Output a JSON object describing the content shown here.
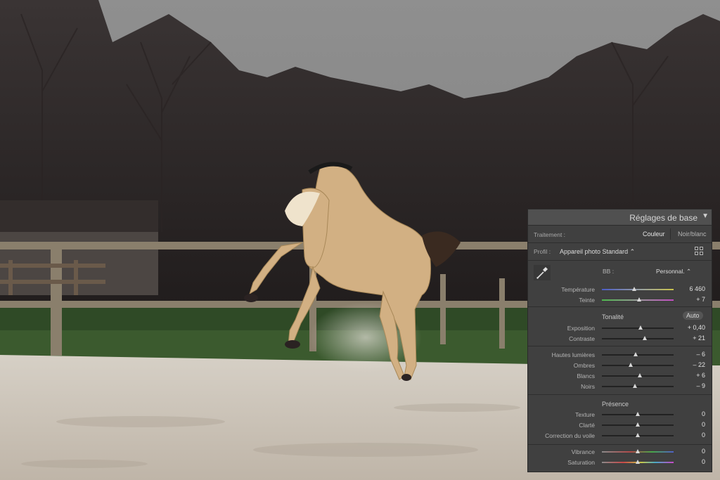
{
  "panel": {
    "title": "Réglages de base",
    "collapse_icon": "triangle-down-icon",
    "treatment": {
      "label": "Traitement :",
      "options": [
        "Couleur",
        "Noir/blanc"
      ],
      "selected": "Couleur"
    },
    "profile": {
      "label": "Profil :",
      "value": "Appareil photo Standard  ⌃",
      "browse_icon": "grid-icon"
    },
    "white_balance": {
      "label": "BB :",
      "value": "Personnal.  ⌃",
      "eyedropper_icon": "eyedropper-icon",
      "sliders": [
        {
          "label": "Température",
          "value": "6 460",
          "level": 0.45
        },
        {
          "label": "Teinte",
          "value": "+ 7",
          "level": 0.52
        }
      ]
    },
    "tone": {
      "title": "Tonalité",
      "auto_label": "Auto",
      "sliders": [
        {
          "label": "Exposition",
          "value": "+ 0,40",
          "level": 0.54
        },
        {
          "label": "Contraste",
          "value": "+ 21",
          "level": 0.6
        }
      ],
      "detail_sliders": [
        {
          "label": "Hautes lumières",
          "value": "– 6",
          "level": 0.47
        },
        {
          "label": "Ombres",
          "value": "– 22",
          "level": 0.4
        },
        {
          "label": "Blancs",
          "value": "+ 6",
          "level": 0.53
        },
        {
          "label": "Noirs",
          "value": "– 9",
          "level": 0.46
        }
      ]
    },
    "presence": {
      "title": "Présence",
      "sliders": [
        {
          "label": "Texture",
          "value": "0",
          "level": 0.5
        },
        {
          "label": "Clarté",
          "value": "0",
          "level": 0.5
        },
        {
          "label": "Correction du voile",
          "value": "0",
          "level": 0.5
        }
      ],
      "color_sliders": [
        {
          "label": "Vibrance",
          "value": "0",
          "level": 0.5
        },
        {
          "label": "Saturation",
          "value": "0",
          "level": 0.5
        }
      ]
    }
  },
  "colors": {
    "panel_bg": "#404040",
    "header_bg": "#505050",
    "text": "#c8c8c8",
    "sky": "#8d8d8d",
    "grass": "#2f4a26",
    "sand": "#cfc6ba",
    "horse": "#d2b083"
  }
}
